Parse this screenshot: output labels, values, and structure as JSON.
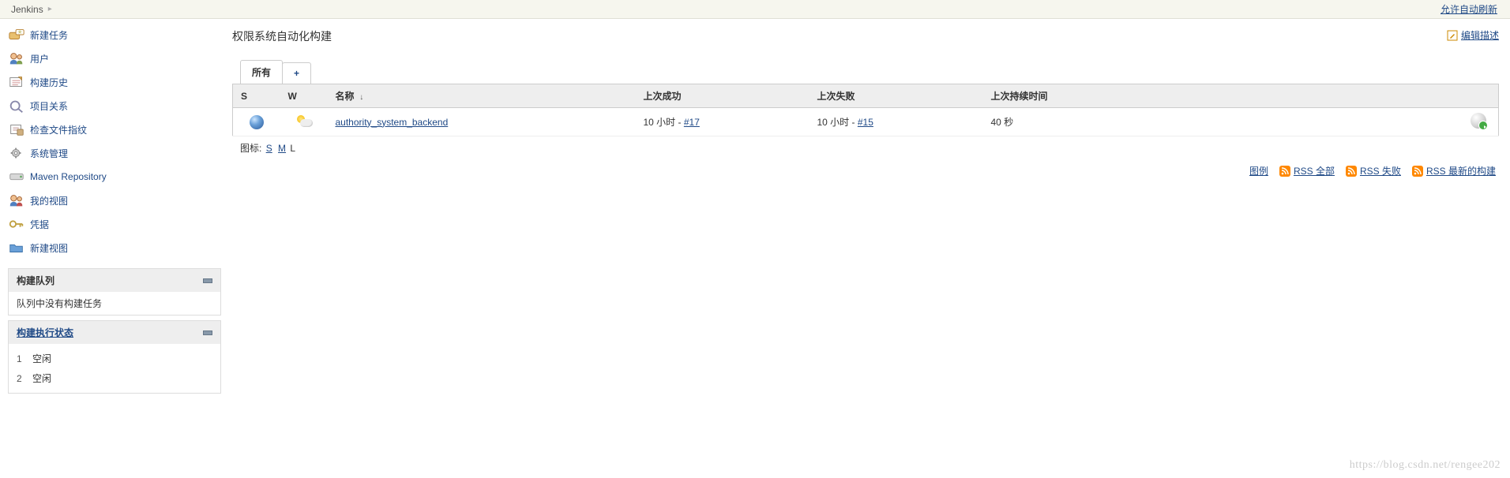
{
  "breadcrumb": {
    "root": "Jenkins"
  },
  "header": {
    "auto_refresh": "允许自动刷新"
  },
  "sidebar": {
    "items": [
      {
        "label": "新建任务",
        "icon": "new-item-icon"
      },
      {
        "label": "用户",
        "icon": "people-icon"
      },
      {
        "label": "构建历史",
        "icon": "history-icon"
      },
      {
        "label": "项目关系",
        "icon": "relations-icon"
      },
      {
        "label": "检查文件指纹",
        "icon": "fingerprint-icon"
      },
      {
        "label": "系统管理",
        "icon": "manage-icon"
      },
      {
        "label": "Maven Repository",
        "icon": "maven-icon"
      },
      {
        "label": "我的视图",
        "icon": "myview-icon"
      },
      {
        "label": "凭据",
        "icon": "credentials-icon"
      },
      {
        "label": "新建视图",
        "icon": "newview-icon"
      }
    ],
    "build_queue": {
      "title": "构建队列",
      "empty_msg": "队列中没有构建任务"
    },
    "executors": {
      "title": "构建执行状态",
      "rows": [
        {
          "num": "1",
          "status": "空闲"
        },
        {
          "num": "2",
          "status": "空闲"
        }
      ]
    }
  },
  "main": {
    "title": "权限系统自动化构建",
    "edit_desc": "编辑描述",
    "tabs": {
      "all": "所有",
      "add": "+"
    },
    "columns": {
      "s": "S",
      "w": "W",
      "name": "名称",
      "success": "上次成功",
      "failure": "上次失败",
      "duration": "上次持续时间"
    },
    "rows": [
      {
        "name": "authority_system_backend",
        "success_text": "10 小时 - ",
        "success_link": "#17",
        "failure_text": "10 小时 - ",
        "failure_link": "#15",
        "duration": "40 秒"
      }
    ],
    "icon_size": {
      "label": "图标:",
      "s": "S",
      "m": "M",
      "l": "L"
    },
    "footer_links": {
      "legend": "图例",
      "rss_all": "RSS 全部",
      "rss_fail": "RSS 失败",
      "rss_latest": "RSS 最新的构建"
    }
  },
  "watermark": "https://blog.csdn.net/rengee202"
}
